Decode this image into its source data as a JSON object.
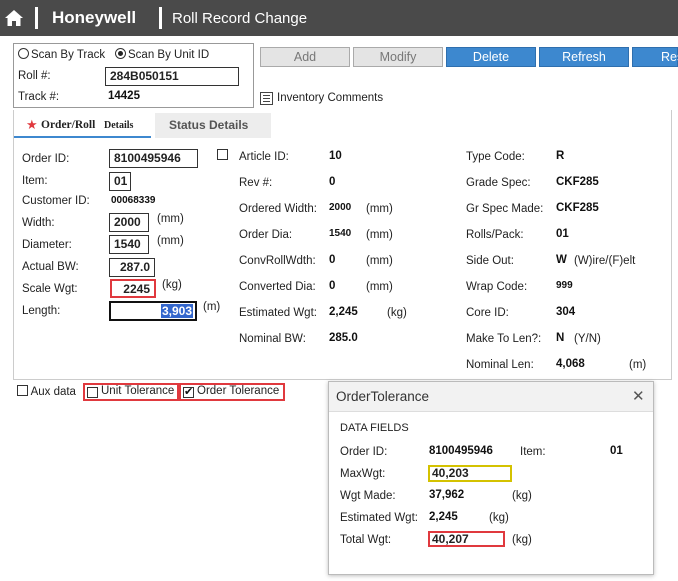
{
  "header": {
    "brand": "Honeywell",
    "title": "Roll Record Change"
  },
  "scan": {
    "by_track_label": "Scan By Track",
    "by_unit_label": "Scan By Unit ID",
    "selected": "unit",
    "roll_label": "Roll #:",
    "roll_value": "284B050151",
    "track_label": "Track #:",
    "track_value": "14425"
  },
  "toolbar": {
    "add": "Add",
    "modify": "Modify",
    "delete": "Delete",
    "refresh": "Refresh",
    "reset": "Res"
  },
  "inventory_comments": "Inventory Comments",
  "tabs": {
    "order_roll": "Order/Roll",
    "details": "Details",
    "status": "Status Details"
  },
  "left": {
    "order_id_label": "Order ID:",
    "order_id": "8100495946",
    "item_label": "Item:",
    "item": "01",
    "customer_id_label": "Customer ID:",
    "customer_id": "00068339",
    "width_label": "Width:",
    "width": "2000",
    "width_unit": "(mm)",
    "diameter_label": "Diameter:",
    "diameter": "1540",
    "diameter_unit": "(mm)",
    "actual_bw_label": "Actual BW:",
    "actual_bw": "287.0",
    "scale_wgt_label": "Scale Wgt:",
    "scale_wgt": "2245",
    "scale_wgt_unit": "(kg)",
    "length_label": "Length:",
    "length": "3,903",
    "length_unit": "(m)"
  },
  "middle": {
    "article_id_label": "Article ID:",
    "article_id": "10",
    "rev_label": "Rev #:",
    "rev": "0",
    "ordered_width_label": "Ordered Width:",
    "ordered_width": "2000",
    "ordered_width_unit": "(mm)",
    "order_dia_label": "Order Dia:",
    "order_dia": "1540",
    "order_dia_unit": "(mm)",
    "convroll_label": "ConvRollWdth:",
    "convroll": "0",
    "convroll_unit": "(mm)",
    "converted_dia_label": "Converted Dia:",
    "converted_dia": "0",
    "converted_dia_unit": "(mm)",
    "est_wgt_label": "Estimated Wgt:",
    "est_wgt": "2,245",
    "est_wgt_unit": "(kg)",
    "nominal_bw_label": "Nominal BW:",
    "nominal_bw": "285.0"
  },
  "right": {
    "type_code_label": "Type Code:",
    "type_code": "R",
    "grade_spec_label": "Grade Spec:",
    "grade_spec": "CKF285",
    "gr_spec_made_label": "Gr Spec Made:",
    "gr_spec_made": "CKF285",
    "rolls_pack_label": "Rolls/Pack:",
    "rolls_pack": "01",
    "side_out_label": "Side Out:",
    "side_out": "W",
    "side_out_hint": "(W)ire/(F)elt",
    "wrap_code_label": "Wrap Code:",
    "wrap_code": "999",
    "core_id_label": "Core ID:",
    "core_id": "304",
    "make_to_len_label": "Make To Len?:",
    "make_to_len": "N",
    "make_to_len_hint": "(Y/N)",
    "nominal_len_label": "Nominal Len:",
    "nominal_len": "4,068",
    "nominal_len_unit": "(m)"
  },
  "bottom": {
    "aux_data": "Aux data",
    "unit_tolerance": "Unit Tolerance",
    "order_tolerance": "Order Tolerance"
  },
  "popup": {
    "title": "OrderTolerance",
    "section": "DATA FIELDS",
    "order_id_label": "Order ID:",
    "order_id": "8100495946",
    "item_label": "Item:",
    "item": "01",
    "max_wgt_label": "MaxWgt:",
    "max_wgt": "40,203",
    "wgt_made_label": "Wgt Made:",
    "wgt_made": "37,962",
    "wgt_made_unit": "(kg)",
    "est_wgt_label": "Estimated Wgt:",
    "est_wgt": "2,245",
    "est_wgt_unit": "(kg)",
    "total_wgt_label": "Total Wgt:",
    "total_wgt": "40,207",
    "total_wgt_unit": "(kg)"
  },
  "colors": {
    "header_bg": "#4a4a4a",
    "accent_blue": "#3d88cf",
    "highlight_red": "#e0393e",
    "highlight_yellow": "#d4c200",
    "selection_blue": "#3366cc"
  }
}
